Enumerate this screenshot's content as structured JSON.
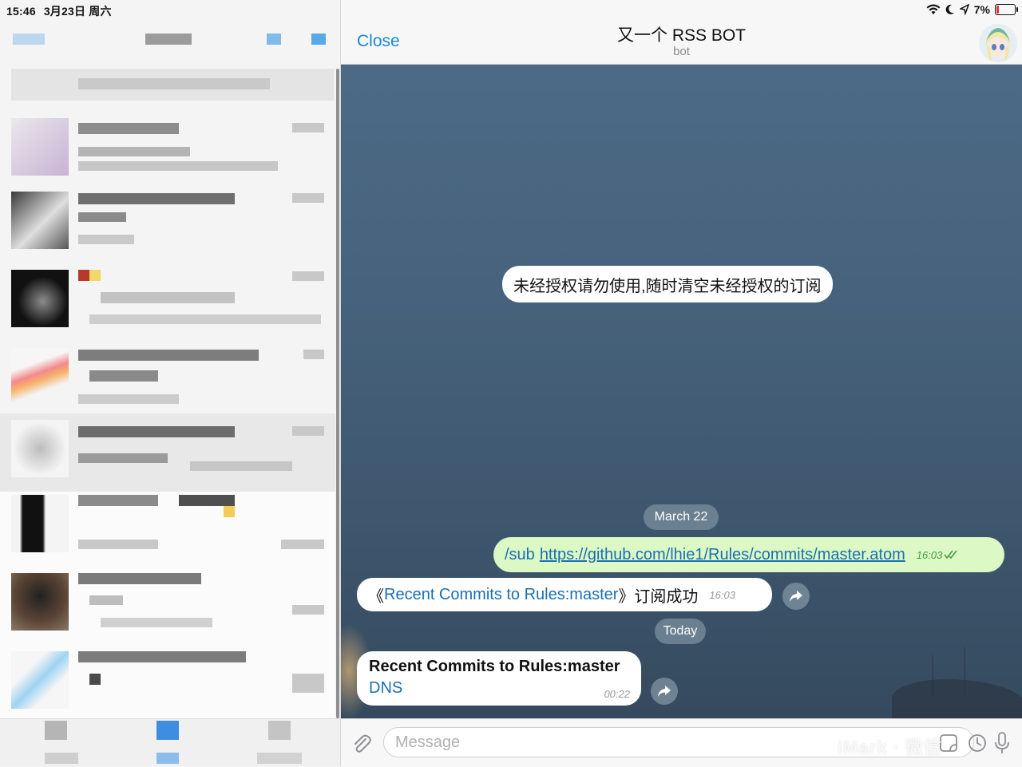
{
  "status_bar": {
    "time": "15:46",
    "date": "3月23日 周六",
    "battery": "7%"
  },
  "chat": {
    "close_label": "Close",
    "title": "又一个 RSS BOT",
    "subtitle": "bot",
    "notice": "未经授权请勿使用,随时清空未经授权的订阅",
    "date_march": "March 22",
    "date_today": "Today",
    "outgoing": {
      "command": "/sub",
      "link": "https://github.com/lhie1/Rules/commits/master.atom",
      "time": "16:03"
    },
    "incoming_1": {
      "open_quote": "《",
      "name": "Recent Commits to Rules:master",
      "close_quote": "》订阅成功",
      "time": "16:03"
    },
    "incoming_2": {
      "title": "Recent Commits to Rules:master",
      "link": "DNS",
      "time": "00:22"
    }
  },
  "input": {
    "placeholder": "Message",
    "watermark": "iMark · 微信"
  },
  "colors": {
    "accent": "#1a88d8",
    "outgoing_bubble": "#dcf8c5",
    "chat_background": "#47627c"
  }
}
